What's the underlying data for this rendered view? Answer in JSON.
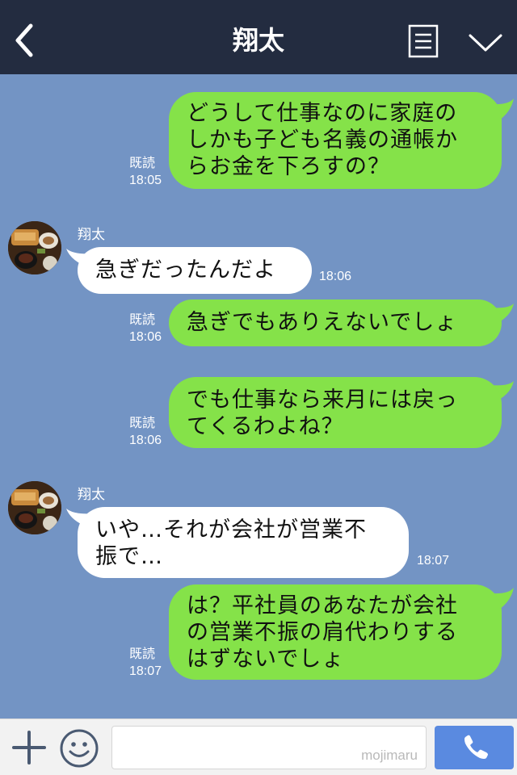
{
  "header": {
    "title": "翔太",
    "back_icon": "chevron-left-icon",
    "menu_icon": "notes-icon",
    "collapse_icon": "chevron-down-icon"
  },
  "messages": [
    {
      "from": "me",
      "lines": [
        "どうして仕事なのに家庭の",
        "しかも子ども名義の通帳か",
        "らお金を下ろすの？"
      ],
      "read": "既読",
      "time": "18:05"
    },
    {
      "from": "them",
      "name": "翔太",
      "lines": [
        "急ぎだったんだよ"
      ],
      "time": "18:06"
    },
    {
      "from": "me",
      "lines": [
        "急ぎでもありえないでしょ"
      ],
      "read": "既読",
      "time": "18:06"
    },
    {
      "from": "me",
      "lines": [
        "でも仕事なら来月には戻っ",
        "てくるわよね？"
      ],
      "read": "既読",
      "time": "18:06"
    },
    {
      "from": "them",
      "name": "翔太",
      "lines": [
        "いや…それが会社が営業不",
        "振で…"
      ],
      "time": "18:07"
    },
    {
      "from": "me",
      "lines": [
        "は？平社員のあなたが会社",
        "の営業不振の肩代わりする",
        "はずないでしょ"
      ],
      "read": "既読",
      "time": "18:07"
    }
  ],
  "bottom_bar": {
    "input_value": "",
    "watermark": "mojimaru",
    "plus_icon": "plus-icon",
    "emoji_icon": "smiley-icon",
    "call_icon": "phone-icon"
  },
  "colors": {
    "header_bg": "#232c40",
    "chat_bg": "#7394c4",
    "my_bubble": "#85e249",
    "their_bubble": "#ffffff",
    "call_button": "#5a8ae0"
  }
}
